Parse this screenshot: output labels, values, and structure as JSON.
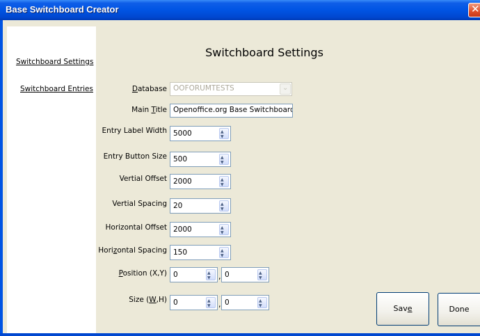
{
  "window": {
    "title": "Base Switchboard Creator",
    "close_glyph": "✕"
  },
  "nav": {
    "items": [
      {
        "label": "Switchboard Settings"
      },
      {
        "label": "Switchboard Entries"
      }
    ]
  },
  "main": {
    "heading": "Switchboard Settings",
    "database": {
      "label_pre": "",
      "label_key": "D",
      "label_post": "atabase",
      "value": "OOFORUMTESTS"
    },
    "main_title": {
      "label_pre": "Main ",
      "label_key": "T",
      "label_post": "itle",
      "value": "Openoffice.org Base Switchboard"
    },
    "entry_label_width": {
      "label": "Entry Label Width",
      "value": "5000"
    },
    "entry_button_size": {
      "label": "Entry Button Size",
      "value": "500"
    },
    "vertical_offset": {
      "label": "Vertial Offset",
      "value": "2000"
    },
    "vertical_spacing": {
      "label": "Vertial Spacing",
      "value": "20"
    },
    "horizontal_offset": {
      "label": "Horizontal Offset",
      "value": "2000"
    },
    "horizontal_spacing": {
      "label_pre": "Hori",
      "label_key": "z",
      "label_post": "ontal Spacing",
      "value": "150"
    },
    "position": {
      "label_pre": "",
      "label_key": "P",
      "label_post": "osition (X,Y)",
      "x": "0",
      "y": "0"
    },
    "size": {
      "label_pre": "Size (",
      "label_key": "W",
      "label_post": ",H)",
      "w": "0",
      "h": "0"
    },
    "separator": ","
  },
  "buttons": {
    "save": {
      "label_pre": "Sav",
      "label_key": "e",
      "label_post": ""
    },
    "done": {
      "label": "Done"
    }
  },
  "spin": {
    "up": "▲",
    "down": "▼"
  },
  "combo_arrow": "⌄"
}
